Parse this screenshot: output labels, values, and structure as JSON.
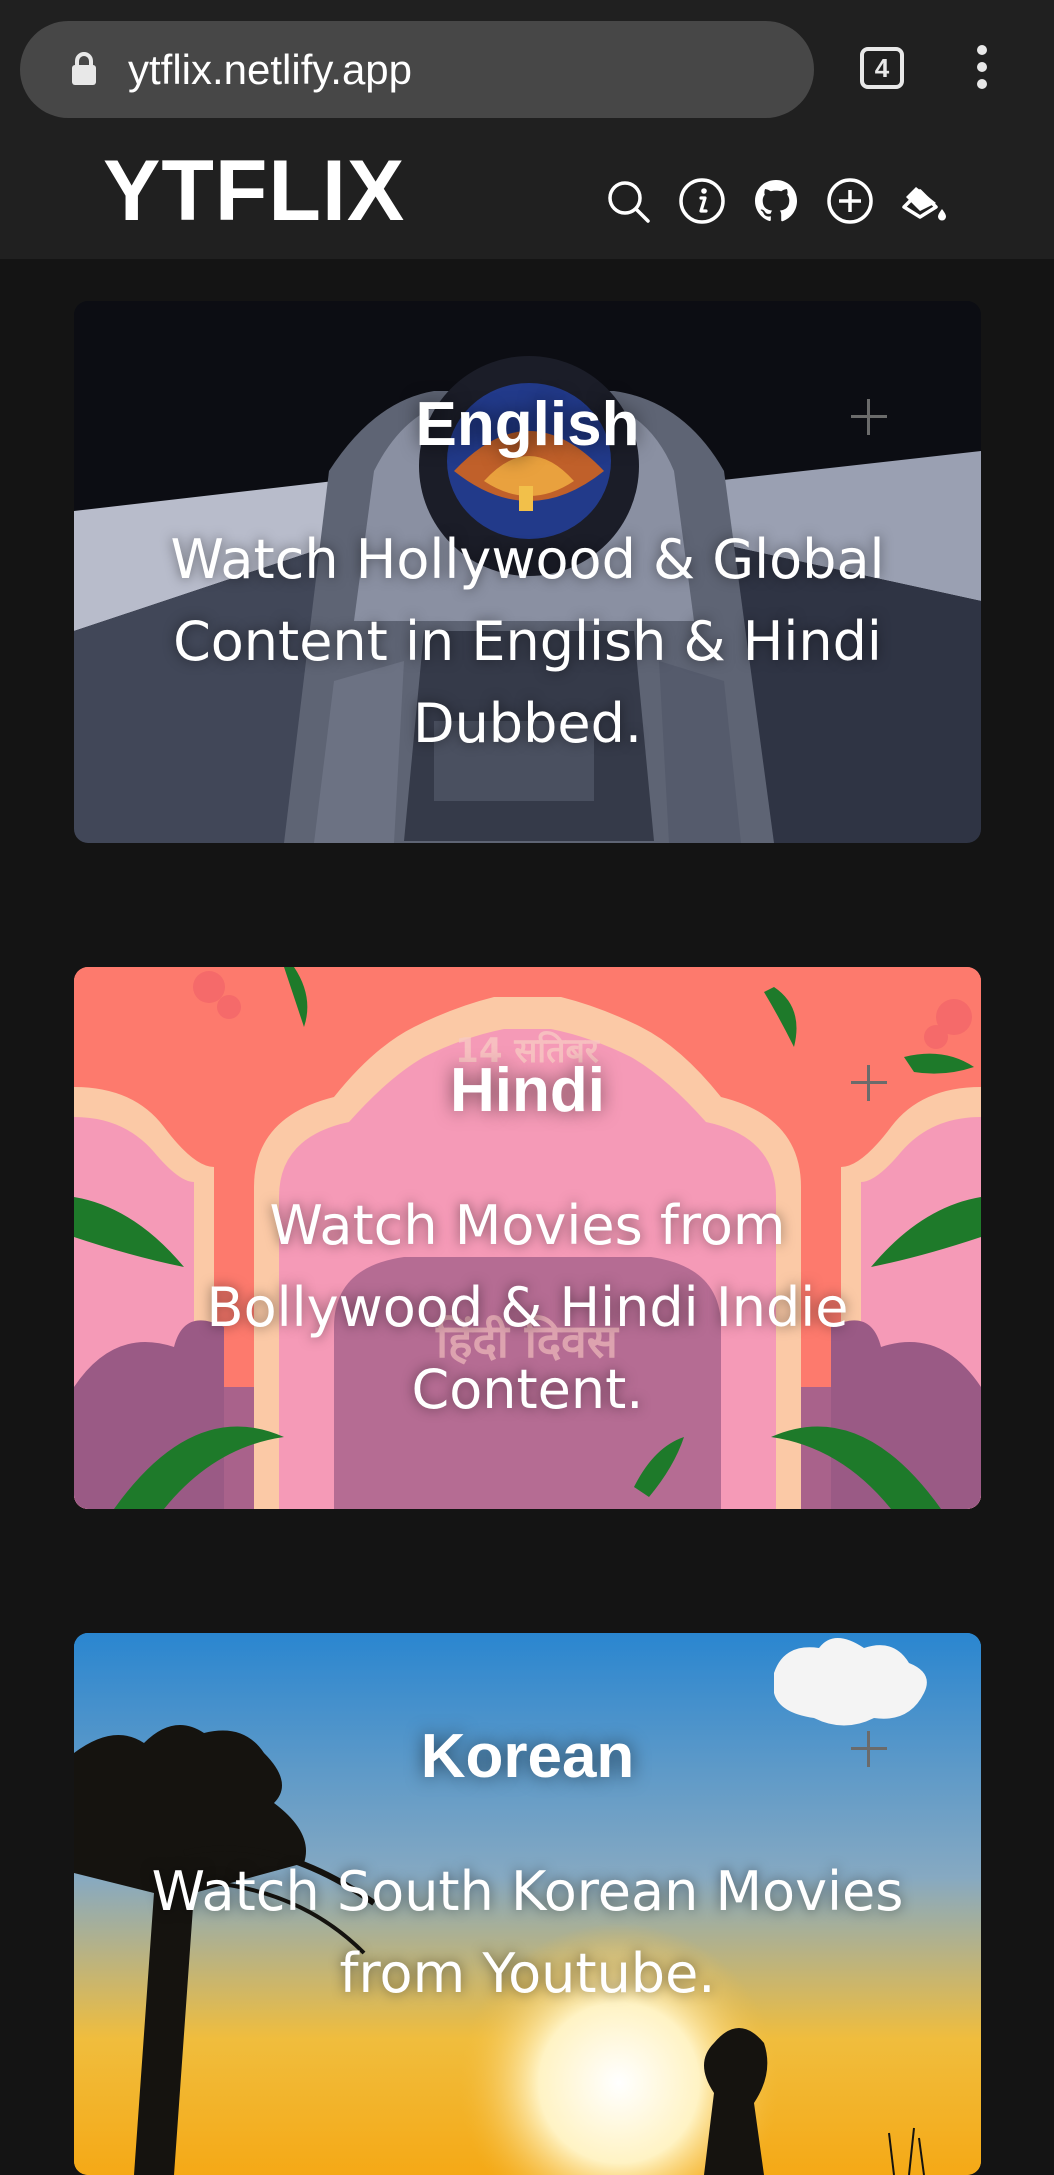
{
  "browser": {
    "url": "ytflix.netlify.app",
    "tab_count": "4",
    "icons": [
      "lock-icon",
      "tabs-icon",
      "more-vert-icon"
    ]
  },
  "header": {
    "logo": "YTFLIX",
    "icons": [
      "search-icon",
      "info-icon",
      "github-icon",
      "add-circle-icon",
      "paint-bucket-icon"
    ]
  },
  "categories": [
    {
      "title": "English",
      "description": "Watch Hollywood & Global Content in English & Hindi Dubbed."
    },
    {
      "title": "Hindi",
      "description": "Watch Movies from Bollywood & Hindi Indie Content."
    },
    {
      "title": "Korean",
      "description": "Watch South Korean Movies from Youtube."
    }
  ],
  "colors": {
    "background": "#141414",
    "header": "#202020",
    "url_pill": "#474747",
    "hindi_card": "#ff7a6e"
  }
}
